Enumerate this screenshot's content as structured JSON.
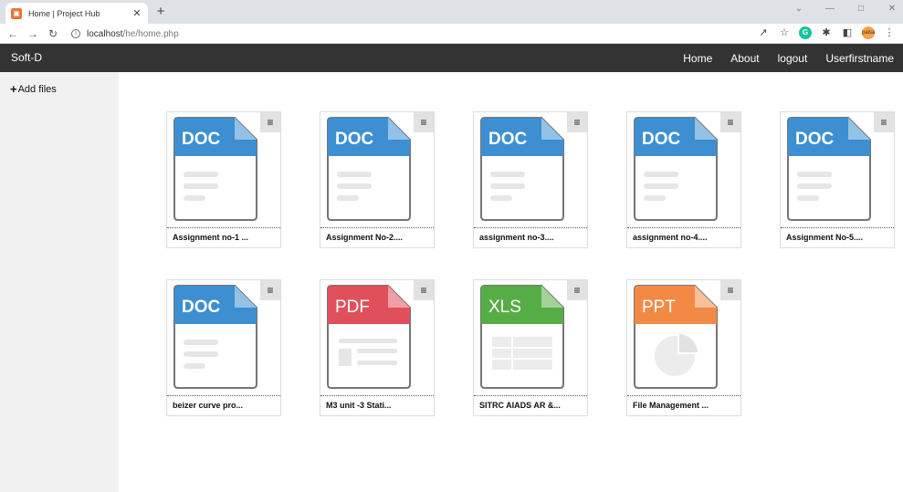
{
  "browser": {
    "tab_title": "Home | Project Hub",
    "url_host": "localhost",
    "url_path": "/he/home.php",
    "avatar_text": "paisa"
  },
  "navbar": {
    "brand": "Soft-D",
    "links": [
      "Home",
      "About",
      "logout",
      "Userfirstname"
    ]
  },
  "sidebar": {
    "add_files_label": "Add files"
  },
  "file_types": {
    "doc": {
      "label": "DOC",
      "color": "#3d8fd1"
    },
    "pdf": {
      "label": "PDF",
      "color": "#e0505a"
    },
    "xls": {
      "label": "XLS",
      "color": "#57ad45"
    },
    "ppt": {
      "label": "PPT",
      "color": "#f28a46"
    }
  },
  "files": [
    {
      "name": "Assignment no-1 ...",
      "type": "doc"
    },
    {
      "name": "Assignment No-2....",
      "type": "doc"
    },
    {
      "name": "assignment no-3....",
      "type": "doc"
    },
    {
      "name": "assignment no-4....",
      "type": "doc"
    },
    {
      "name": "Assignment No-5....",
      "type": "doc"
    },
    {
      "name": "beizer curve pro...",
      "type": "doc"
    },
    {
      "name": "M3 unit -3 Stati...",
      "type": "pdf"
    },
    {
      "name": "SITRC AIADS AR &...",
      "type": "xls"
    },
    {
      "name": "File Management ...",
      "type": "ppt"
    }
  ]
}
